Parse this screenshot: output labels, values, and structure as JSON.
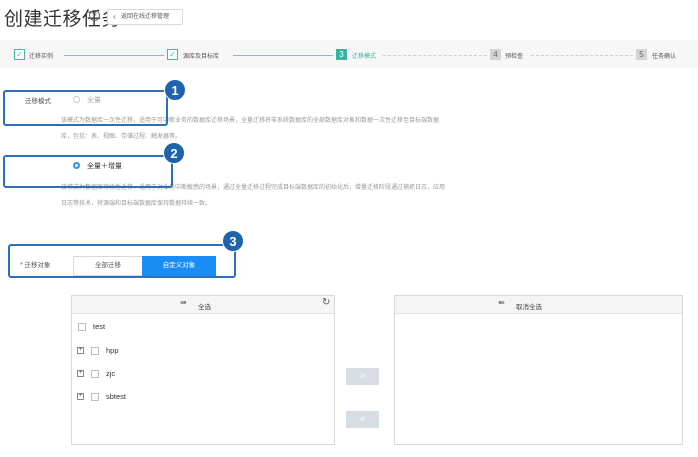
{
  "header": {
    "title": "创建迁移任务",
    "help_icon": "?",
    "back_label": "返回在线迁移管理"
  },
  "steps": [
    {
      "index": "1",
      "label": "迁移实例",
      "state": "done"
    },
    {
      "index": "2",
      "label": "源库及目标库",
      "state": "done"
    },
    {
      "index": "3",
      "label": "迁移模式",
      "state": "active"
    },
    {
      "index": "4",
      "label": "预检查",
      "state": "todo"
    },
    {
      "index": "5",
      "label": "任务确认",
      "state": "todo"
    }
  ],
  "migration_mode": {
    "label": "迁移模式",
    "options": [
      {
        "label": "全量",
        "checked": false,
        "description_line1": "该模式为数据库一次性迁移，适用于可中断业务的数据库迁移场景，全量迁移将非系统数据库的全部数据库对象和数据一次性迁移至目标端数据",
        "description_line2": "库，包括：表、视图、存储过程、触发器等。"
      },
      {
        "label": "全量＋增量",
        "checked": true,
        "description_line1": "该模式为数据库持续性迁移，适用于对业务中断敏感的场景，通过全量迁移过程完成目标端数据库的初始化后，增量迁移阶段通过捕抓日志，应用",
        "description_line2": "日志等技术，将源端和目标端数据库保持数据持续一致。"
      }
    ]
  },
  "migration_object": {
    "required_mark": "*",
    "label": "迁移对象",
    "options": [
      "全部迁移",
      "自定义对象"
    ],
    "selected": "自定义对象"
  },
  "callouts": [
    "1",
    "2",
    "3"
  ],
  "left_panel": {
    "select_all_label": "全选",
    "select_all_icon": "⇛",
    "refresh_icon": "↻",
    "items": [
      {
        "label": "test",
        "expandable": false
      },
      {
        "label": "hpp",
        "expandable": true
      },
      {
        "label": "zjc",
        "expandable": true
      },
      {
        "label": "sbtest",
        "expandable": true
      }
    ]
  },
  "right_panel": {
    "deselect_all_label": "取消全选",
    "deselect_all_icon": "⇚"
  },
  "move_buttons": {
    "right": "»",
    "left": "«"
  },
  "colors": {
    "accent_green": "#31b6a0",
    "accent_blue": "#1a8cf5",
    "callout_blue": "#1f63ad"
  }
}
